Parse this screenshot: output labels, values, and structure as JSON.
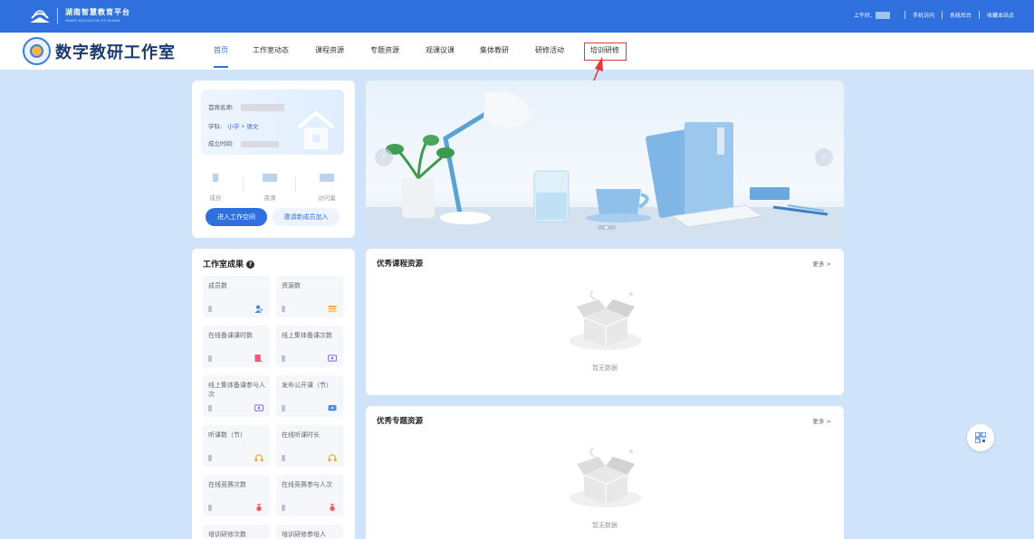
{
  "topbar": {
    "title": "湖南智慧教育平台",
    "subtitle": "SMART EDUCATION OF HUNAN",
    "greeting": "上午好,",
    "links": [
      "手机访问",
      "系统后台",
      "收藏本站点"
    ]
  },
  "header": {
    "brand": "数字教研工作室",
    "nav": [
      "首页",
      "工作室动态",
      "课程资源",
      "专题资源",
      "观课议课",
      "集体教研",
      "研修活动",
      "培训研修"
    ],
    "active_index": 0,
    "highlighted_index": 7
  },
  "profile": {
    "teacher_label": "首席名师:",
    "subject_label": "学科:",
    "subject_value": "小学 • 语文",
    "founded_label": "成立时间:",
    "stats": [
      "成员",
      "资源",
      "访问量"
    ],
    "enter_button": "进入工作空间",
    "invite_button": "邀请新成员加入"
  },
  "achievements": {
    "title": "工作室成果",
    "tiles": [
      {
        "label": "成员数",
        "icon": "people-icon",
        "color": "#4d8de8"
      },
      {
        "label": "资源数",
        "icon": "stack-icon",
        "color": "#f5a524"
      },
      {
        "label": "在线备课课时数",
        "icon": "doc-icon",
        "color": "#f05a7a"
      },
      {
        "label": "线上集体备课次数",
        "icon": "screen-icon",
        "color": "#8a72e6"
      },
      {
        "label": "线上集体备课参与人次",
        "icon": "screen-icon",
        "color": "#8a72e6"
      },
      {
        "label": "发布公开课（节）",
        "icon": "video-icon",
        "color": "#4d8de8"
      },
      {
        "label": "听课数（节）",
        "icon": "headphone-icon",
        "color": "#f5a524"
      },
      {
        "label": "在线听课时长",
        "icon": "headphone-icon",
        "color": "#f5a524"
      },
      {
        "label": "在线竞赛次数",
        "icon": "medal-icon",
        "color": "#f05a5a"
      },
      {
        "label": "在线竞赛参与人次",
        "icon": "medal-icon",
        "color": "#f05a5a"
      },
      {
        "label": "培训研修次数",
        "icon": "book-icon",
        "color": "#4d8de8"
      },
      {
        "label": "培训研修参培人",
        "icon": "book-icon",
        "color": "#4d8de8"
      }
    ]
  },
  "resources": {
    "course": {
      "title": "优秀课程资源",
      "more": "更多 >",
      "empty": "暂无数据"
    },
    "topic": {
      "title": "优秀专题资源",
      "more": "更多 >",
      "empty": "暂无数据"
    }
  },
  "colors": {
    "primary": "#2f6fde",
    "background": "#cfe4fb",
    "highlight": "#e53935"
  }
}
